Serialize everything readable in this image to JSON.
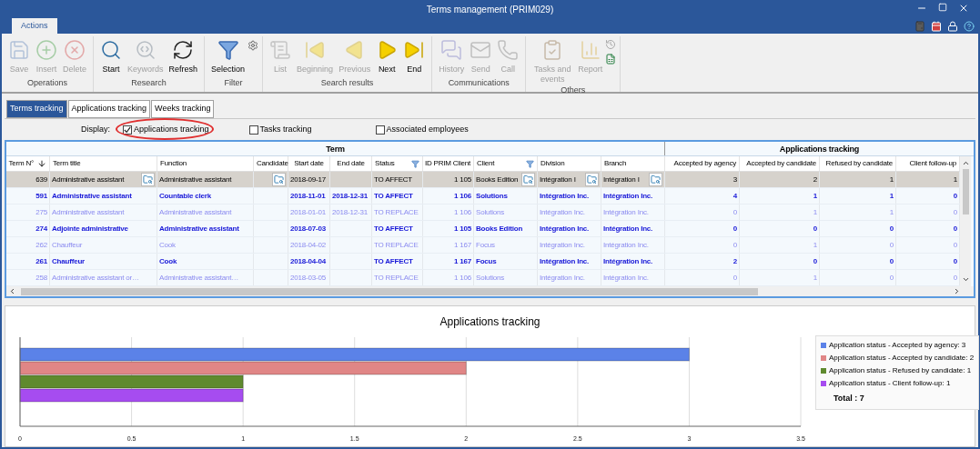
{
  "window": {
    "title": "Terms management (PRIM029)"
  },
  "ribbon": {
    "tab": {
      "label": "Actions",
      "selected": true
    },
    "groups": [
      {
        "label": "Operations",
        "buttons": [
          {
            "label": "Save",
            "disabled": true
          },
          {
            "label": "Insert",
            "disabled": true
          },
          {
            "label": "Delete",
            "disabled": true
          }
        ]
      },
      {
        "label": "Research",
        "buttons": [
          {
            "label": "Start",
            "disabled": false
          },
          {
            "label": "Keywords",
            "disabled": true
          },
          {
            "label": "Refresh",
            "disabled": false
          }
        ]
      },
      {
        "label": "Filter",
        "buttons": [
          {
            "label": "Selection",
            "disabled": false
          }
        ]
      },
      {
        "label": "Search results",
        "buttons": [
          {
            "label": "List",
            "disabled": true
          },
          {
            "label": "Beginning",
            "disabled": true
          },
          {
            "label": "Previous",
            "disabled": true
          },
          {
            "label": "Next",
            "disabled": false
          },
          {
            "label": "End",
            "disabled": false
          }
        ]
      },
      {
        "label": "Communications",
        "buttons": [
          {
            "label": "History",
            "disabled": true
          },
          {
            "label": "Send",
            "disabled": true
          },
          {
            "label": "Call",
            "disabled": true
          }
        ]
      },
      {
        "label": "Others",
        "buttons": [
          {
            "label": "Tasks and events",
            "disabled": true
          },
          {
            "label": "Report",
            "disabled": true
          }
        ]
      }
    ]
  },
  "tabs": [
    {
      "label": "Terms tracking",
      "selected": true
    },
    {
      "label": "Applications tracking",
      "selected": false
    },
    {
      "label": "Weeks tracking",
      "selected": false
    }
  ],
  "display": {
    "label": "Display:",
    "options": [
      {
        "label": "Applications tracking",
        "checked": true
      },
      {
        "label": "Tasks tracking",
        "checked": false
      },
      {
        "label": "Associated employees",
        "checked": false
      }
    ]
  },
  "table": {
    "groups": [
      "Term",
      "Applications tracking"
    ],
    "columns": [
      {
        "label": "Term N°",
        "kind": "number",
        "sorted": true
      },
      {
        "label": "Term title",
        "kind": "text",
        "lookup": true
      },
      {
        "label": "Function",
        "kind": "text"
      },
      {
        "label": "Candidate",
        "kind": "text",
        "lookup": true
      },
      {
        "label": "Start date",
        "kind": "date"
      },
      {
        "label": "End date",
        "kind": "date"
      },
      {
        "label": "Status",
        "kind": "text",
        "filter": true
      },
      {
        "label": "ID PRIM Client",
        "kind": "number"
      },
      {
        "label": "Client",
        "kind": "text",
        "filter": true,
        "lookup": true
      },
      {
        "label": "Division",
        "kind": "text",
        "lookup": true
      },
      {
        "label": "Branch",
        "kind": "text",
        "lookup": true
      },
      {
        "label": "Accepted by agency",
        "kind": "number"
      },
      {
        "label": "Accepted by candidate",
        "kind": "number"
      },
      {
        "label": "Refused by candidate",
        "kind": "number"
      },
      {
        "label": "Client follow-up",
        "kind": "number"
      }
    ],
    "rows": [
      {
        "selected": true,
        "dimmed": false,
        "cells": [
          "639",
          "Administrative assistant",
          "Administrative assistant",
          null,
          "2018-09-17",
          null,
          "TO AFFECT",
          "1 105",
          "Books Edition",
          "Intégration I",
          "Intégration I",
          "3",
          "2",
          "1",
          "1"
        ]
      },
      {
        "selected": false,
        "dimmed": false,
        "cells": [
          "591",
          "Administrative assistant",
          "Countable clerk",
          null,
          "2018-11-01",
          "2018-12-31",
          "TO AFFECT",
          "1 106",
          "Solutions",
          "Intégration Inc.",
          "Intégration Inc.",
          "4",
          "1",
          "1",
          "0"
        ]
      },
      {
        "selected": false,
        "dimmed": true,
        "cells": [
          "275",
          "Administrative assistant",
          "Administrative assistant",
          null,
          "2018-01-01",
          "2018-12-31",
          "TO REPLACE",
          "1 106",
          "Solutions",
          "Intégration Inc.",
          "Intégration Inc.",
          "0",
          "1",
          "1",
          "0"
        ]
      },
      {
        "selected": false,
        "dimmed": false,
        "cells": [
          "274",
          "Adjointe administrative",
          "Administrative assistant",
          null,
          "2018-07-03",
          null,
          "TO AFFECT",
          "1 105",
          "Books Edition",
          "Intégration Inc.",
          "Intégration Inc.",
          "0",
          "0",
          "0",
          "0"
        ]
      },
      {
        "selected": false,
        "dimmed": true,
        "cells": [
          "262",
          "Chauffeur",
          "Cook",
          null,
          "2018-04-02",
          null,
          "TO REPLACE",
          "1 167",
          "Focus",
          "Intégration Inc.",
          "Intégration Inc.",
          "0",
          "1",
          "0",
          "0"
        ]
      },
      {
        "selected": false,
        "dimmed": false,
        "cells": [
          "261",
          "Chauffeur",
          "Cook",
          null,
          "2018-04-04",
          null,
          "TO AFFECT",
          "1 167",
          "Focus",
          "Intégration Inc.",
          "Intégration Inc.",
          "2",
          "0",
          "0",
          "0"
        ]
      },
      {
        "selected": false,
        "dimmed": true,
        "cells": [
          "258",
          "Administrative assistant or…",
          "Administrative assistant…",
          null,
          "2018-03-05",
          null,
          "TO REPLACE",
          "1 106",
          "Solutions",
          "Intégration Inc.",
          "Intégration Inc.",
          "0",
          "1",
          "0",
          "0"
        ]
      }
    ]
  },
  "chart": {
    "title": "Applications tracking",
    "chart_data": {
      "type": "bar",
      "orientation": "horizontal",
      "grid": true,
      "xlim": [
        0,
        3.5
      ],
      "xticks": [
        0,
        0.5,
        1,
        1.5,
        2,
        2.5,
        3,
        3.5
      ],
      "series": [
        {
          "color": "#5b82e8",
          "values": [
            3
          ]
        },
        {
          "color": "#e08686",
          "values": [
            2
          ]
        },
        {
          "color": "#5f8a2e",
          "values": [
            1
          ]
        },
        {
          "color": "#a64cf0",
          "values": [
            1
          ]
        }
      ]
    },
    "legend": [
      {
        "label": "Application status - Accepted by agency: 3",
        "color": "#5b82e8"
      },
      {
        "label": "Application status - Accepted by candidate: 2",
        "color": "#e08686"
      },
      {
        "label": "Application status - Refused by candidate: 1",
        "color": "#5f8a2e"
      },
      {
        "label": "Application status - Client follow-up: 1",
        "color": "#a64cf0"
      }
    ],
    "total": "Total : 7"
  }
}
